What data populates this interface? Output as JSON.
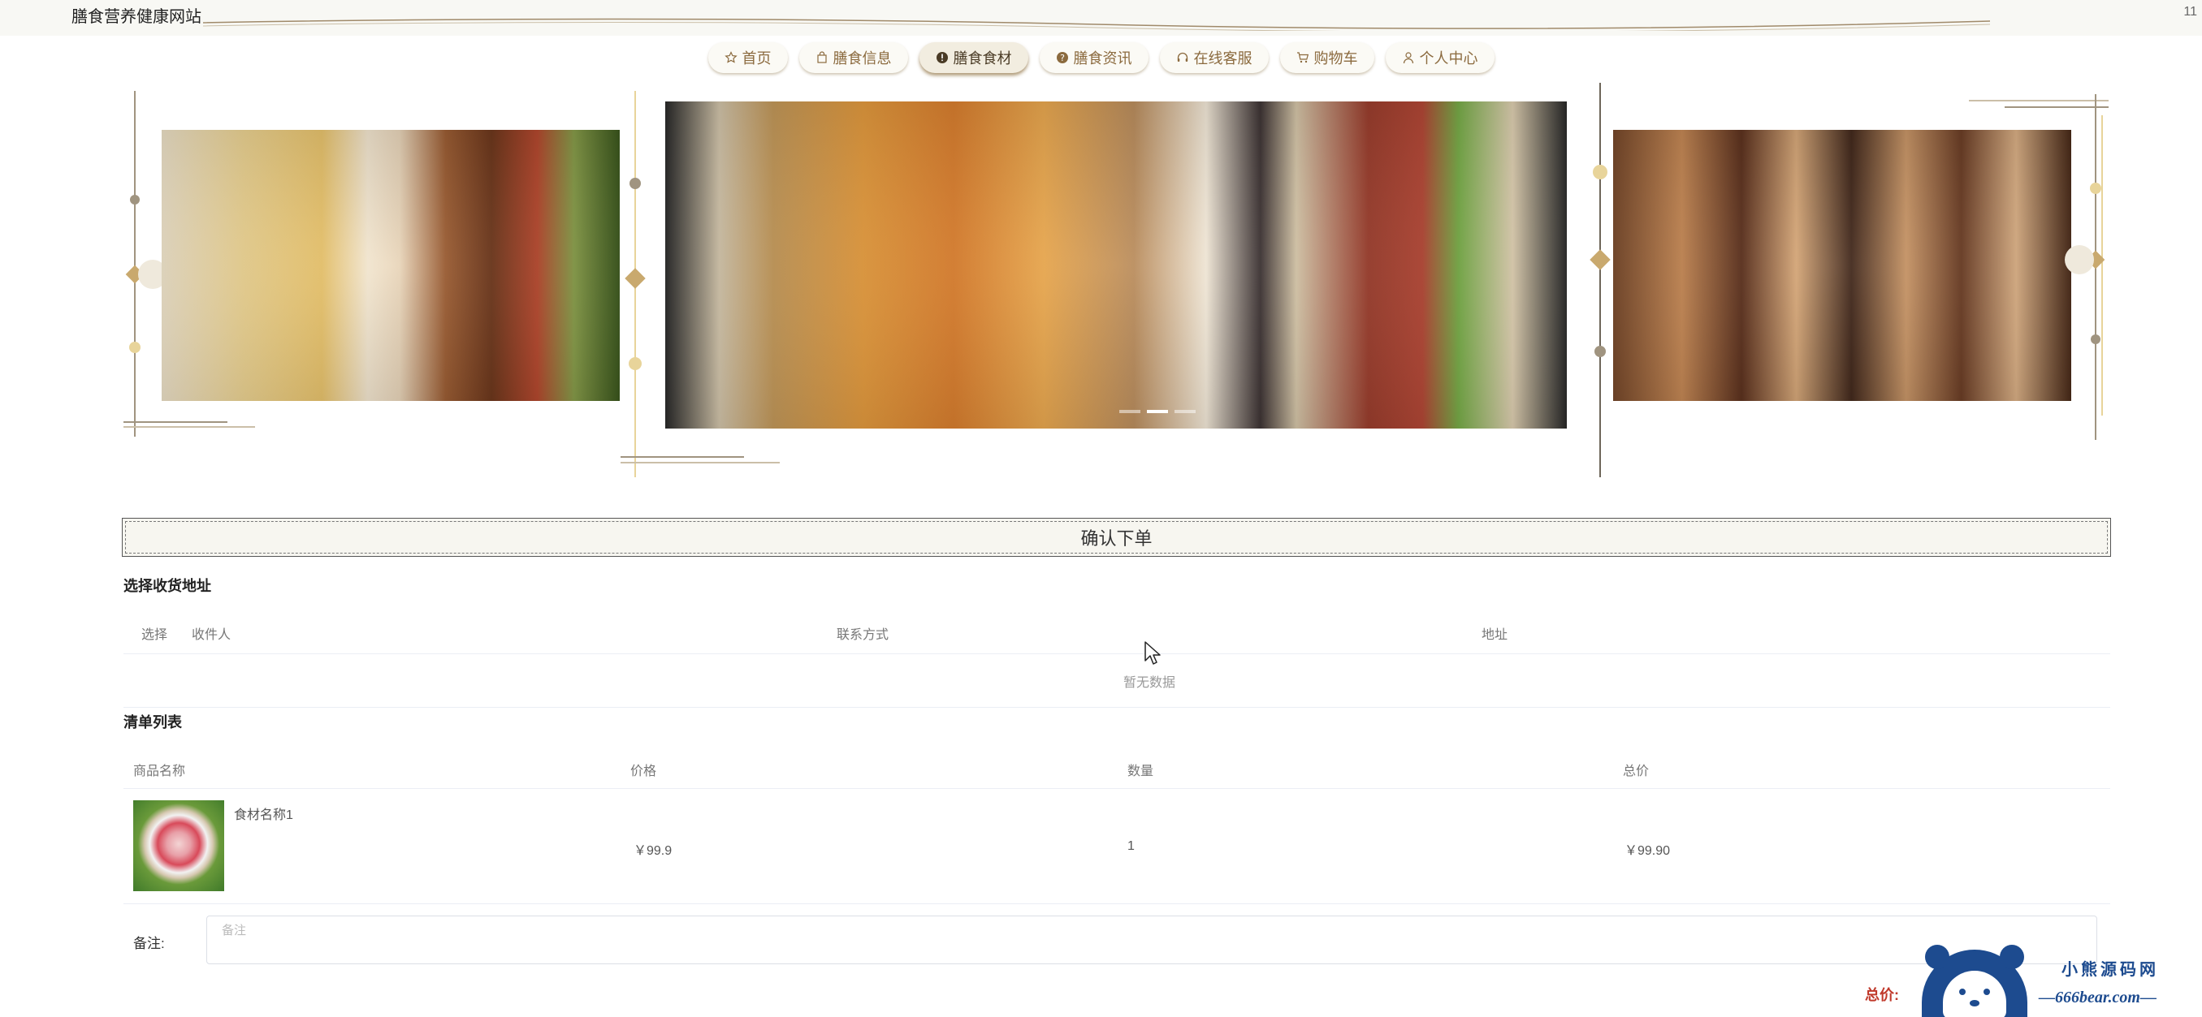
{
  "site": {
    "title": "膳食营养健康网站",
    "corner_number": "11"
  },
  "nav": {
    "items": [
      {
        "label": "首页",
        "icon": "star-icon",
        "active": false
      },
      {
        "label": "膳食信息",
        "icon": "bag-icon",
        "active": false
      },
      {
        "label": "膳食食材",
        "icon": "info-icon",
        "active": true
      },
      {
        "label": "膳食资讯",
        "icon": "question-icon",
        "active": false
      },
      {
        "label": "在线客服",
        "icon": "headset-icon",
        "active": false
      },
      {
        "label": "购物车",
        "icon": "cart-icon",
        "active": false
      },
      {
        "label": "个人中心",
        "icon": "user-icon",
        "active": false
      }
    ]
  },
  "carousel": {
    "slide_count": 3,
    "active_slide": 1
  },
  "order": {
    "header": "确认下单",
    "address_section": {
      "title": "选择收货地址",
      "columns": [
        "选择",
        "收件人",
        "联系方式",
        "地址"
      ],
      "empty_text": "暂无数据"
    },
    "list_section": {
      "title": "清单列表",
      "columns": [
        "商品名称",
        "价格",
        "数量",
        "总价"
      ],
      "rows": [
        {
          "name": "食材名称1",
          "price": "￥99.9",
          "quantity": "1",
          "total": "￥99.90"
        }
      ]
    },
    "remark": {
      "label": "备注:",
      "placeholder": "备注",
      "value": ""
    },
    "total_label": "总价:"
  },
  "watermark": {
    "title": "小熊源码网",
    "url": "—666bear.com—"
  },
  "colors": {
    "nav_text": "#8b6a3e",
    "accent_gold": "#c9a96e",
    "total_red": "#c0392b",
    "watermark_blue": "#1d4b8f"
  }
}
